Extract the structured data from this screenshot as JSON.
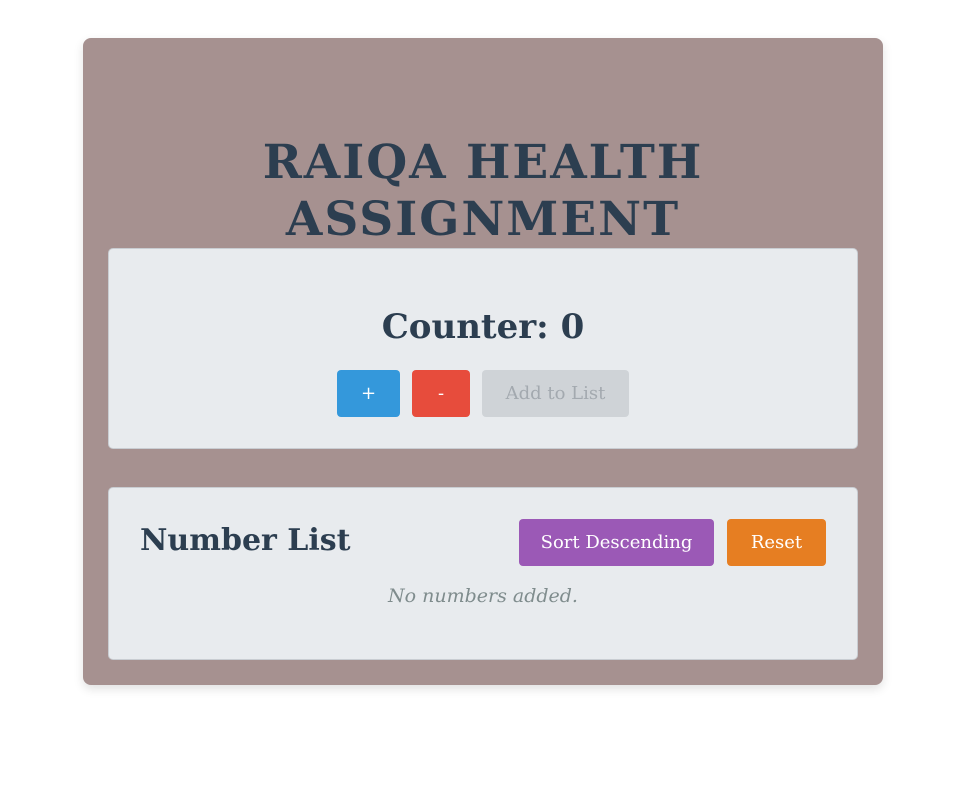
{
  "app": {
    "title_line1": "RAIQA HEALTH",
    "title_line2": "ASSIGNMENT"
  },
  "counter": {
    "label": "Counter: 0",
    "increment_label": "+",
    "decrement_label": "-",
    "add_label": "Add to List"
  },
  "number_list": {
    "heading": "Number List",
    "sort_label": "Sort Descending",
    "reset_label": "Reset",
    "empty_message": "No numbers added."
  },
  "colors": {
    "container_bg": "#a69190",
    "card_bg": "#e8ebee",
    "text_primary": "#2c3e50",
    "increment": "#3498db",
    "decrement": "#e74c3c",
    "add_disabled": "#cfd3d7",
    "sort": "#9b59b6",
    "reset": "#e67e22"
  }
}
